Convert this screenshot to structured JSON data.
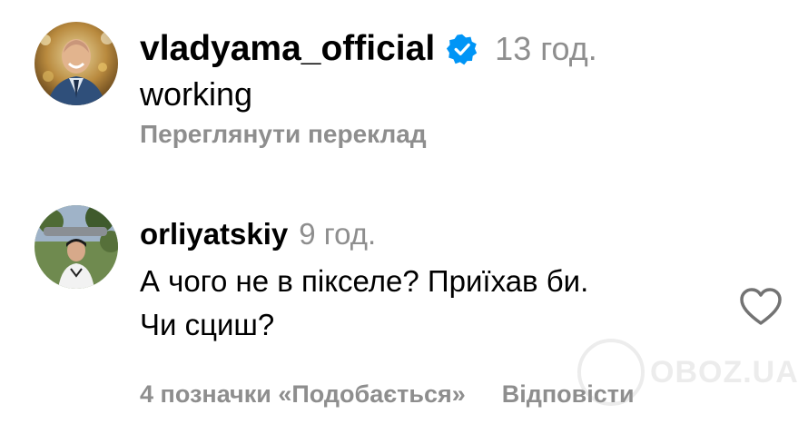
{
  "comments": [
    {
      "username": "vladyama_official",
      "verified": true,
      "time": "13 год.",
      "text": "working",
      "action": "Переглянути переклад",
      "avatar_icon": "user-avatar-man-suit"
    },
    {
      "username": "orliyatskiy",
      "verified": false,
      "time": "9 год.",
      "text_lines": [
        "А чого не в пікселе? Приїхав би.",
        "Чи сциш?"
      ],
      "likes": "4 позначки «Подобається»",
      "reply": "Відповісти",
      "avatar_icon": "user-avatar-man-park"
    }
  ],
  "icons": {
    "verified": "verified-badge-icon",
    "like": "heart-icon"
  },
  "watermark": {
    "text": "OBOZ.UA"
  },
  "colors": {
    "primary_text": "#000000",
    "secondary_text": "#8e8e8e",
    "verified_blue": "#0095f6",
    "background": "#ffffff"
  }
}
